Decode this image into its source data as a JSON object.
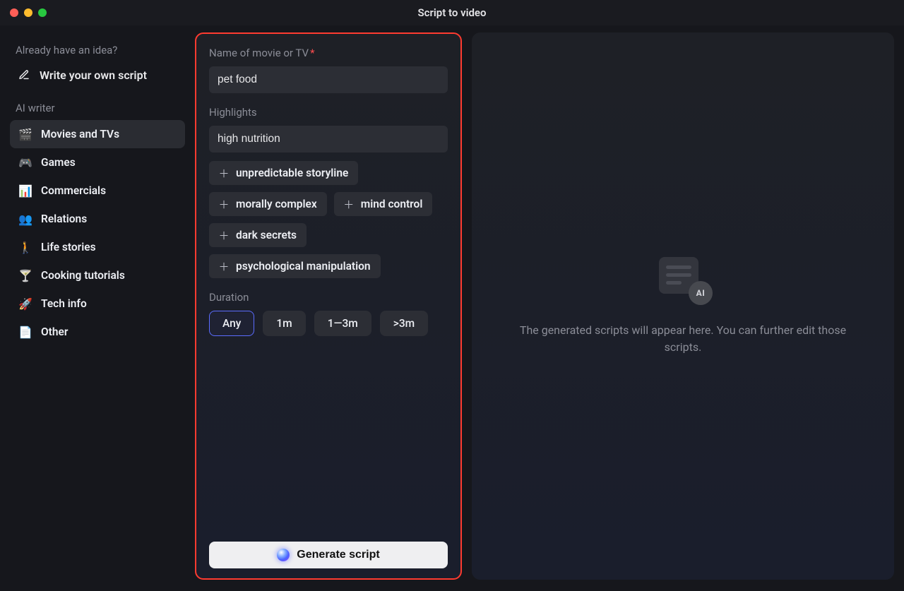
{
  "window": {
    "title": "Script to video"
  },
  "sidebar": {
    "idea_label": "Already have an idea?",
    "write_own_label": "Write your own script",
    "ai_writer_label": "AI writer",
    "items": [
      {
        "label": "Movies and TVs",
        "icon": "clapper-icon",
        "glyph": "🎬",
        "active": true
      },
      {
        "label": "Games",
        "icon": "gamepad-icon",
        "glyph": "🎮",
        "active": false
      },
      {
        "label": "Commercials",
        "icon": "chart-icon",
        "glyph": "📊",
        "active": false
      },
      {
        "label": "Relations",
        "icon": "people-icon",
        "glyph": "👥",
        "active": false
      },
      {
        "label": "Life stories",
        "icon": "person-walk-icon",
        "glyph": "🚶",
        "active": false
      },
      {
        "label": "Cooking tutorials",
        "icon": "cocktail-icon",
        "glyph": "🍸",
        "active": false
      },
      {
        "label": "Tech info",
        "icon": "rocket-icon",
        "glyph": "🚀",
        "active": false
      },
      {
        "label": "Other",
        "icon": "note-icon",
        "glyph": "📄",
        "active": false
      }
    ]
  },
  "form": {
    "name_label": "Name of movie or TV",
    "name_value": "pet food",
    "highlights_label": "Highlights",
    "highlights_value": "high nutrition",
    "suggestions": [
      "unpredictable storyline",
      "morally complex",
      "mind control",
      "dark secrets",
      "psychological manipulation"
    ],
    "duration_label": "Duration",
    "duration_options": [
      "Any",
      "1m",
      "1—3m",
      ">3m"
    ],
    "duration_selected": "Any",
    "generate_label": "Generate script"
  },
  "right": {
    "empty_text": "The generated scripts will appear here. You can further edit those scripts.",
    "ai_badge": "AI"
  }
}
